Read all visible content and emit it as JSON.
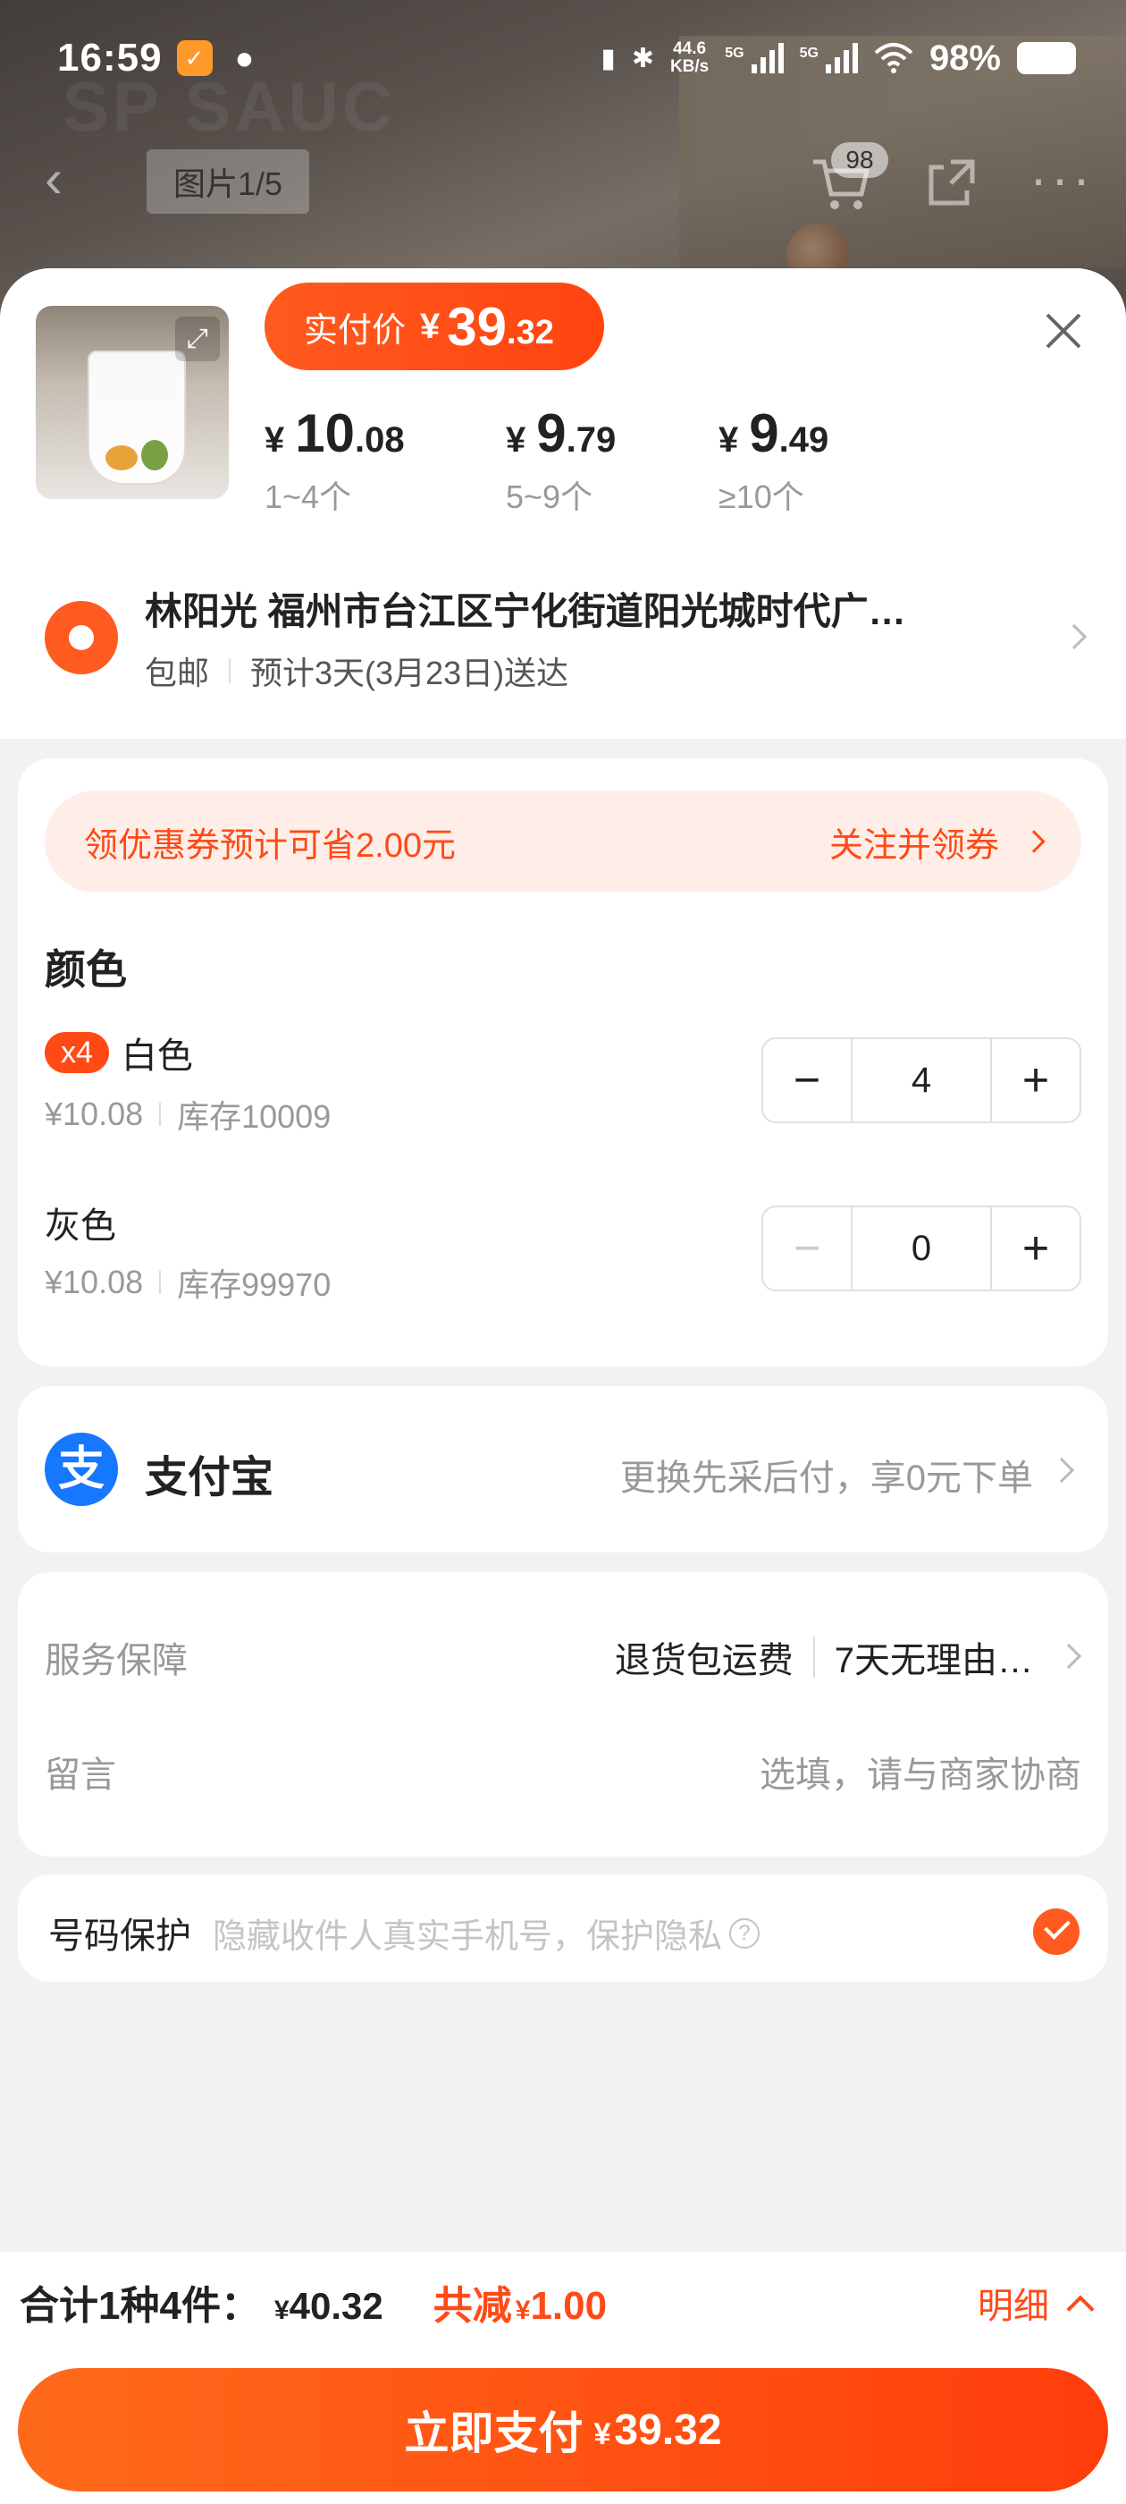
{
  "status_bar": {
    "time": "16:59",
    "net_speed_value": "44.6",
    "net_speed_unit": "KB/s",
    "sim1": "5G",
    "sim2": "5G",
    "battery": "98%"
  },
  "gallery": {
    "counter": "图片1/5",
    "cart_badge": "98"
  },
  "price_header": {
    "pay_label": "实付价",
    "currency": "¥",
    "pay_int": "39",
    "pay_dec": ".32",
    "tiers": [
      {
        "int": "10",
        "dec": ".08",
        "qty": "1~4个"
      },
      {
        "int": "9",
        "dec": ".79",
        "qty": "5~9个"
      },
      {
        "int": "9",
        "dec": ".49",
        "qty": "≥10个"
      }
    ]
  },
  "address": {
    "line1": "林阳光 福州市台江区宁化街道阳光城时代广…",
    "shipping": "包邮",
    "eta": "预计3天(3月23日)送达"
  },
  "coupon": {
    "text": "领优惠券预计可省2.00元",
    "action": "关注并领券"
  },
  "sku": {
    "section_title": "颜色",
    "items": [
      {
        "badge": "x4",
        "name": "白色",
        "price": "¥10.08",
        "stock": "库存10009",
        "qty": "4"
      },
      {
        "badge": "",
        "name": "灰色",
        "price": "¥10.08",
        "stock": "库存99970",
        "qty": "0"
      }
    ]
  },
  "payment": {
    "name": "支付宝",
    "logo_glyph": "支",
    "hint": "更换先采后付，享0元下单"
  },
  "service": {
    "label": "服务保障",
    "tag1": "退货包运费",
    "tag2": "7天无理由…",
    "memo_label": "留言",
    "memo_placeholder": "选填，请与商家协商"
  },
  "privacy": {
    "label": "号码保护",
    "hint": "隐藏收件人真实手机号，保护隐私",
    "qmark": "?",
    "checked": true
  },
  "bottom": {
    "count_label": "合计1种4件：",
    "currency": "¥",
    "total": "40.32",
    "discount_label": "共减",
    "discount": "1.00",
    "detail": "明细",
    "pay_button": "立即支付",
    "pay_amount": "39.32"
  },
  "colors": {
    "accent": "#ff4a16",
    "alipay": "#1677ff",
    "coupon_bg": "#ffeee8"
  }
}
